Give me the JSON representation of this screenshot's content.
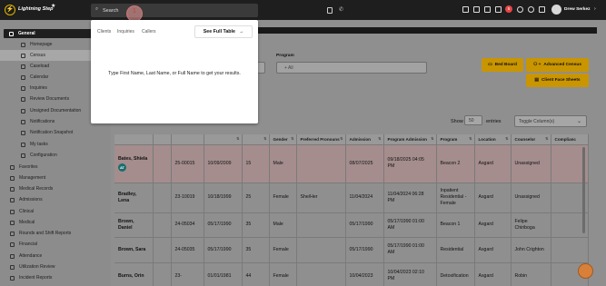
{
  "app": {
    "title": "Lightning Step",
    "logo_glyph": "⚡"
  },
  "topbar": {
    "search_placeholder": "Search",
    "cursor_index": "1",
    "notification_count": "5",
    "user_name": "Drew Serkez",
    "icons": [
      "broadcast-icon",
      "calendar-icon",
      "message-icon",
      "chat-icon",
      "bell-icon",
      "help-icon",
      "link-icon"
    ]
  },
  "search_dropdown": {
    "tabs": [
      "Clients",
      "Inquiries",
      "Callers"
    ],
    "full_table_label": "See Full Table",
    "hint": "Type First Name, Last Name, or Full Name to get your results."
  },
  "sidebar": {
    "general": "General",
    "general_items": [
      {
        "label": "Homepage",
        "icon": "home-icon"
      },
      {
        "label": "Census",
        "icon": "census-icon"
      },
      {
        "label": "Caseload",
        "icon": "person-icon"
      },
      {
        "label": "Calendar",
        "icon": "calendar-icon"
      },
      {
        "label": "Inquiries",
        "icon": "person-icon"
      },
      {
        "label": "Review Documents",
        "icon": "document-icon"
      },
      {
        "label": "Unsigned Documentation",
        "icon": "document-icon"
      },
      {
        "label": "Notifications",
        "icon": "bell-icon"
      },
      {
        "label": "Notification Snapshot",
        "icon": "bell-icon"
      },
      {
        "label": "My tasks",
        "icon": "tasks-icon"
      },
      {
        "label": "Configuration",
        "icon": "gear-icon"
      }
    ],
    "top_items": [
      {
        "label": "Favorites",
        "icon": "heart-icon"
      },
      {
        "label": "Management",
        "icon": "chart-icon"
      },
      {
        "label": "Medical Records",
        "icon": "folder-icon"
      },
      {
        "label": "Admissions",
        "icon": "admissions-icon"
      },
      {
        "label": "Clinical",
        "icon": "clinical-icon"
      },
      {
        "label": "Medical",
        "icon": "medical-icon"
      },
      {
        "label": "Rounds and Shift Reports",
        "icon": "rounds-icon"
      },
      {
        "label": "Financial",
        "icon": "financial-icon"
      },
      {
        "label": "Attendance",
        "icon": "attendance-icon"
      },
      {
        "label": "Utilization Review",
        "icon": "review-icon"
      },
      {
        "label": "Incident Reports",
        "icon": "incident-icon"
      }
    ]
  },
  "filters": {
    "program_label": "Program",
    "program_value": "+ All"
  },
  "buttons": {
    "bed_board": "Bed Board",
    "advanced_census": "Advanced Census",
    "client_face_sheets": "Client Face Sheets"
  },
  "pagination": {
    "show_label": "Show",
    "entries_value": "50",
    "entries_label": "entries",
    "toggle_columns": "Toggle Column(s)"
  },
  "table": {
    "columns": [
      "",
      "",
      "",
      "",
      "Gender",
      "Preferred Pronouns",
      "Admission",
      "Program Admission",
      "Program",
      "Location",
      "Counselor",
      "Complianc"
    ],
    "rows": [
      {
        "name": "Bates, Shiela",
        "avatar": "AT",
        "mr": "25-00015",
        "dob": "10/09/2009",
        "age": "15",
        "gender": "Male",
        "pronouns": "",
        "admission": "08/07/2025",
        "program_admission": "09/18/2025 04:05 PM",
        "program": "Beacon 2",
        "location": "Asgard",
        "counselor": "Unassigned",
        "highlight": true
      },
      {
        "name": "Bradley, Lena",
        "avatar": "",
        "mr": "23-10019",
        "dob": "10/18/1999",
        "age": "25",
        "gender": "Female",
        "pronouns": "She/Her",
        "admission": "11/04/2024",
        "program_admission": "11/04/2024 06:28 PM",
        "program": "Inpatient Residential - Female",
        "location": "Asgard",
        "counselor": "Unassigned",
        "highlight": false
      },
      {
        "name": "Brown, Daniel",
        "avatar": "",
        "mr": "24-05034",
        "dob": "05/17/1990",
        "age": "35",
        "gender": "Male",
        "pronouns": "",
        "admission": "05/17/1990",
        "program_admission": "05/17/1990 01:00 AM",
        "program": "Beacon 1",
        "location": "Asgard",
        "counselor": "Felipe Chiriboga",
        "highlight": false
      },
      {
        "name": "Brown, Sara",
        "avatar": "",
        "mr": "24-05035",
        "dob": "05/17/1990",
        "age": "35",
        "gender": "Female",
        "pronouns": "",
        "admission": "05/17/1990",
        "program_admission": "05/17/1990 01:00 AM",
        "program": "Residential",
        "location": "Asgard",
        "counselor": "John Crighton",
        "highlight": false
      },
      {
        "name": "Burns, Orin",
        "avatar": "",
        "mr": "23-",
        "dob": "01/01/1981",
        "age": "44",
        "gender": "Female",
        "pronouns": "",
        "admission": "10/04/2023",
        "program_admission": "10/04/2023 02:10 PM",
        "program": "Detoxification",
        "location": "Asgard",
        "counselor": "Robin",
        "highlight": false
      }
    ]
  },
  "colors": {
    "accent_gold": "#c99500",
    "topbar": "#1e1e1e",
    "highlight_row": "#a58d8d",
    "badge_red": "#e84545"
  }
}
